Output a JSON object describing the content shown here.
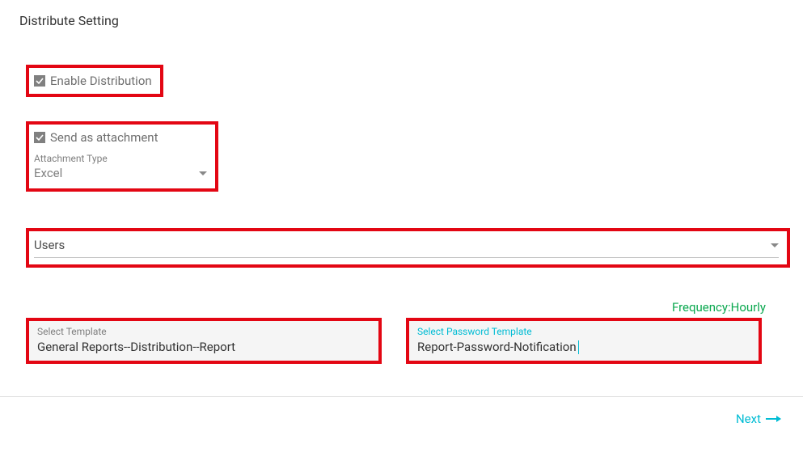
{
  "title": "Distribute Setting",
  "enable_distribution": {
    "checked": true,
    "label": "Enable Distribution"
  },
  "send_as_attachment": {
    "checked": true,
    "label": "Send as attachment"
  },
  "attachment_type": {
    "label": "Attachment Type",
    "value": "Excel"
  },
  "users": {
    "value": "Users"
  },
  "frequency": {
    "label": "Frequency",
    "value": "Hourly"
  },
  "select_template": {
    "label": "Select Template",
    "value": "General Reports--Distribution--Report"
  },
  "select_password_template": {
    "label": "Select Password Template",
    "value": "Report-Password-Notification"
  },
  "next_label": "Next",
  "colors": {
    "highlight_border": "#E30613",
    "accent": "#00BCD4",
    "frequency": "#0AA84F"
  }
}
